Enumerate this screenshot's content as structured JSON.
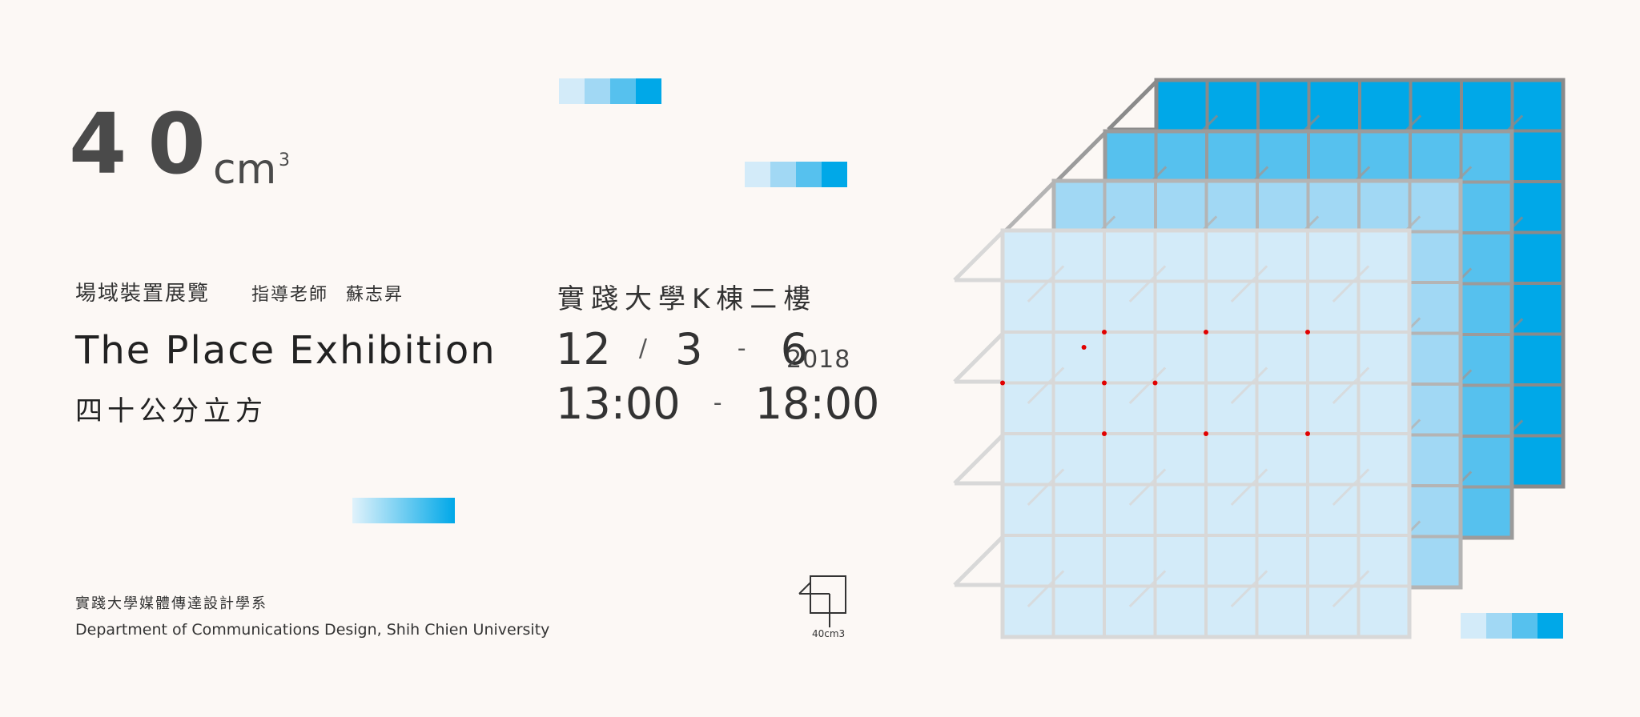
{
  "title": {
    "number": "40",
    "unit": "cm",
    "superscript": "3"
  },
  "subtitle": {
    "category": "場域裝置展覽",
    "advisor_label": "指導老師",
    "advisor_name": "蘇志昇"
  },
  "exhibition": {
    "title_en": "The Place Exhibition",
    "title_zh": "四十公分立方"
  },
  "venue": "實踐大學K棟二樓",
  "date": {
    "month": "12",
    "slash": "/",
    "start_day": "3",
    "dash": "-",
    "end_day": "6",
    "year": "2018"
  },
  "time": {
    "start": "13:00",
    "dash": "-",
    "end": "18:00"
  },
  "department": {
    "zh": "實踐大學媒體傳達設計學系",
    "en": "Department of Communications Design, Shih Chien University"
  },
  "logo": {
    "caption": "40cm3"
  },
  "colors": {
    "background": "#fcf8f5",
    "blue_1": "#d3ebf9",
    "blue_2": "#a1d8f4",
    "blue_3": "#56c1ee",
    "blue_4": "#00a8e8",
    "dot": "#e10000"
  }
}
